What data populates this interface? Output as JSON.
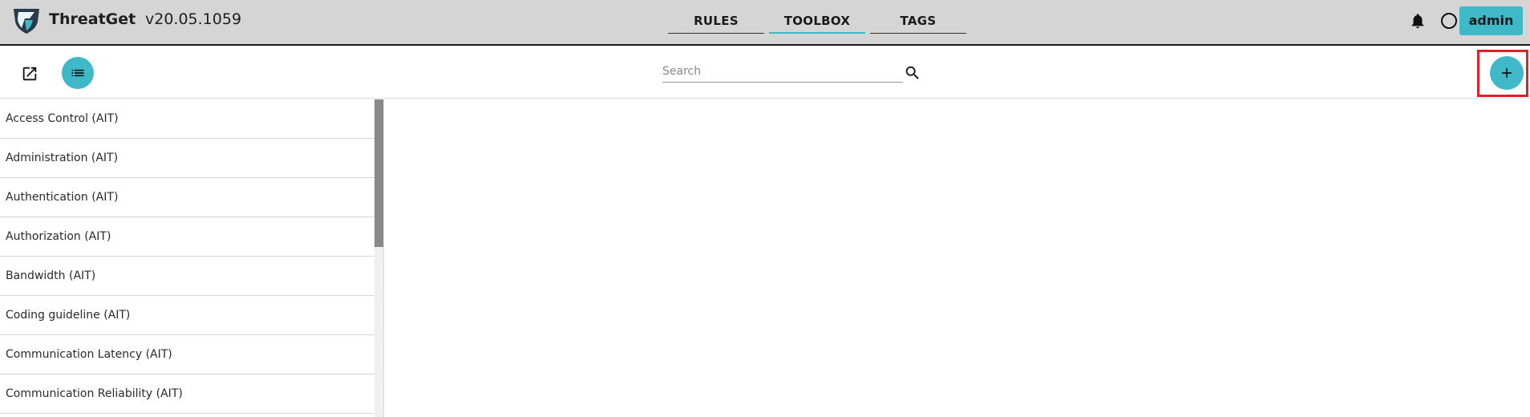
{
  "header": {
    "app_name": "ThreatGet",
    "version": "v20.05.1059",
    "tabs": [
      {
        "label": "RULES",
        "active": false
      },
      {
        "label": "TOOLBOX",
        "active": true
      },
      {
        "label": "TAGS",
        "active": false
      }
    ],
    "user_label": "admin"
  },
  "toolbar": {
    "search_placeholder": "Search"
  },
  "list": {
    "items": [
      "Access Control (AIT)",
      "Administration (AIT)",
      "Authentication (AIT)",
      "Authorization (AIT)",
      "Bandwidth (AIT)",
      "Coding guideline (AIT)",
      "Communication Latency (AIT)",
      "Communication Reliability (AIT)"
    ]
  },
  "colors": {
    "accent": "#3fb8c8",
    "header_bg": "#d5d5d5",
    "highlight": "#e0202a"
  },
  "icons": {
    "logo": "shield-logo-icon",
    "bell": "bell-icon",
    "status": "circle-icon",
    "open": "open-in-new-icon",
    "list": "list-icon",
    "search": "search-icon",
    "add": "plus-icon"
  }
}
